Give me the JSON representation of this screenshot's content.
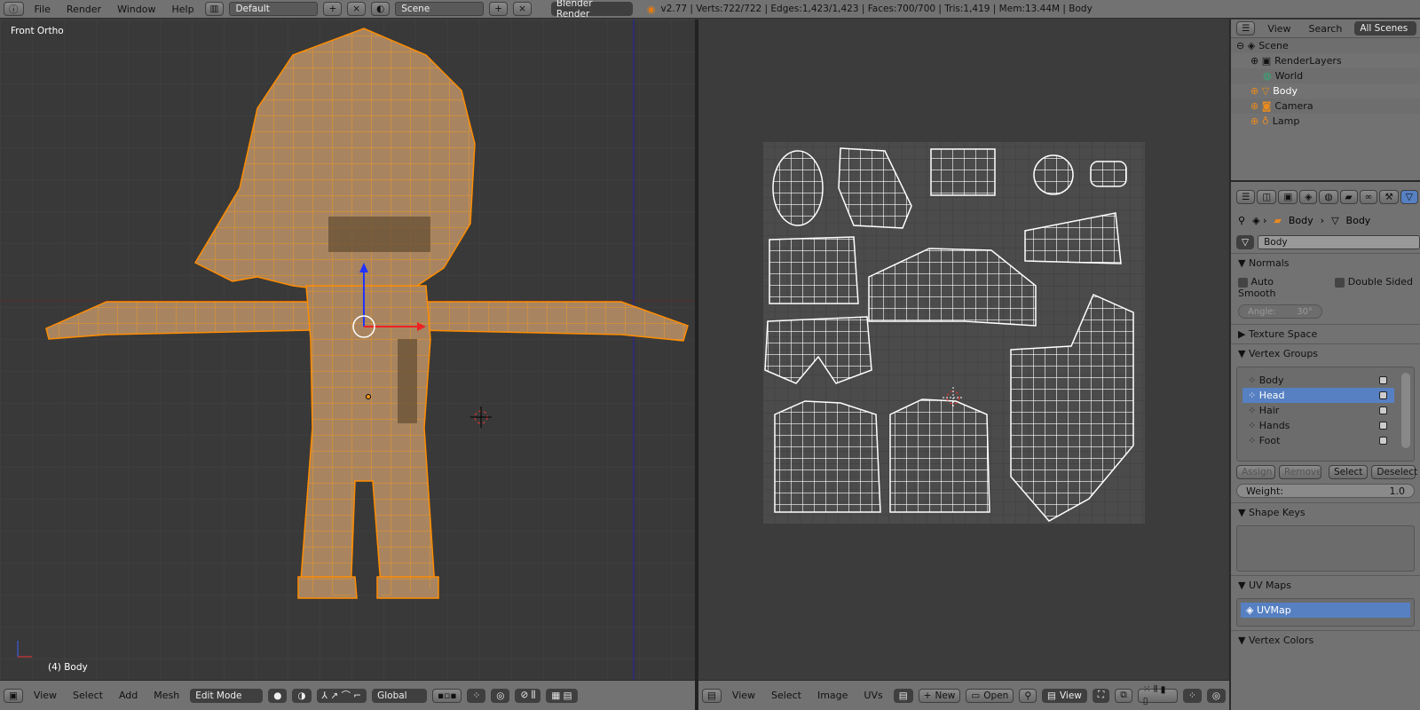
{
  "topbar": {
    "menus": [
      "File",
      "Render",
      "Window",
      "Help"
    ],
    "screen_layout": "Default",
    "scene": "Scene",
    "render_engine": "Blender Render",
    "stats": "v2.77 | Verts:722/722 | Edges:1,423/1,423 | Faces:700/700 | Tris:1,419 | Mem:13.44M | Body"
  },
  "viewport": {
    "view_name": "Front Ortho",
    "object_label": "(4) Body",
    "mesh_color": "#ff8c00"
  },
  "viewport_header": {
    "menus": [
      "View",
      "Select",
      "Add",
      "Mesh"
    ],
    "mode": "Edit Mode",
    "orientation": "Global"
  },
  "uv_header": {
    "menus": [
      "View",
      "Select",
      "Image",
      "UVs"
    ],
    "new_label": "New",
    "open_label": "Open",
    "view_label": "View"
  },
  "outliner": {
    "header": {
      "view": "View",
      "search": "Search",
      "filter": "All Scenes"
    },
    "items": [
      {
        "label": "Scene",
        "icon": "scene-icon"
      },
      {
        "label": "RenderLayers",
        "icon": "render-layers-icon"
      },
      {
        "label": "World",
        "icon": "world-icon"
      },
      {
        "label": "Body",
        "icon": "mesh-object-icon"
      },
      {
        "label": "Camera",
        "icon": "camera-icon"
      },
      {
        "label": "Lamp",
        "icon": "lamp-icon"
      }
    ]
  },
  "properties": {
    "breadcrumb": [
      "Body",
      "Body"
    ],
    "mesh_name": "Body",
    "normals": {
      "title": "Normals",
      "auto_smooth": "Auto Smooth",
      "double_sided": "Double Sided",
      "angle_label": "Angle:",
      "angle_value": "30°"
    },
    "texture_space": "Texture Space",
    "vertex_groups": {
      "title": "Vertex Groups",
      "items": [
        "Body",
        "Head",
        "Hair",
        "Hands",
        "Foot"
      ],
      "selected": "Head",
      "assign": "Assign",
      "remove": "Remove",
      "select": "Select",
      "deselect": "Deselect",
      "weight_label": "Weight:",
      "weight_value": "1.0"
    },
    "shape_keys": "Shape Keys",
    "uv_maps": {
      "title": "UV Maps",
      "items": [
        "UVMap"
      ]
    },
    "vertex_colors": "Vertex Colors",
    "accent": "#5680c2"
  }
}
